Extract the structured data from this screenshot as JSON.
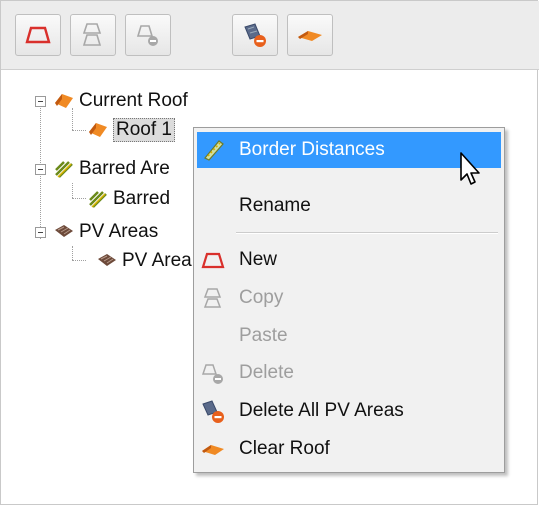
{
  "toolbar": {
    "buttons": [
      {
        "icon": "new-roof-icon",
        "enabled": true
      },
      {
        "icon": "copy-roof-icon",
        "enabled": false
      },
      {
        "icon": "delete-roof-icon",
        "enabled": false
      },
      {
        "icon": "delete-all-pv-areas-icon",
        "enabled": true
      },
      {
        "icon": "clear-roof-icon",
        "enabled": true
      }
    ]
  },
  "tree": {
    "current_roof": {
      "label": "Current Roof",
      "icon": "roof-icon"
    },
    "roof1": {
      "label": "Roof 1",
      "icon": "roof-icon"
    },
    "barred_areas": {
      "label": "Barred Are",
      "icon": "barred-area-icon"
    },
    "barred_child": {
      "label": "Barred",
      "icon": "barred-area-icon"
    },
    "pv_areas": {
      "label": "PV Areas",
      "icon": "pv-area-icon"
    },
    "pv_child": {
      "label": "PV Area",
      "icon": "pv-area-icon"
    }
  },
  "context_menu": {
    "border_distances": "Border Distances",
    "rename": "Rename",
    "new": "New",
    "copy": "Copy",
    "paste": "Paste",
    "delete": "Delete",
    "delete_all_pv": "Delete All PV Areas",
    "clear_roof": "Clear Roof"
  },
  "colors": {
    "highlight": "#3399ff",
    "roof_orange": "#f08a24",
    "new_red": "#d9302c"
  }
}
